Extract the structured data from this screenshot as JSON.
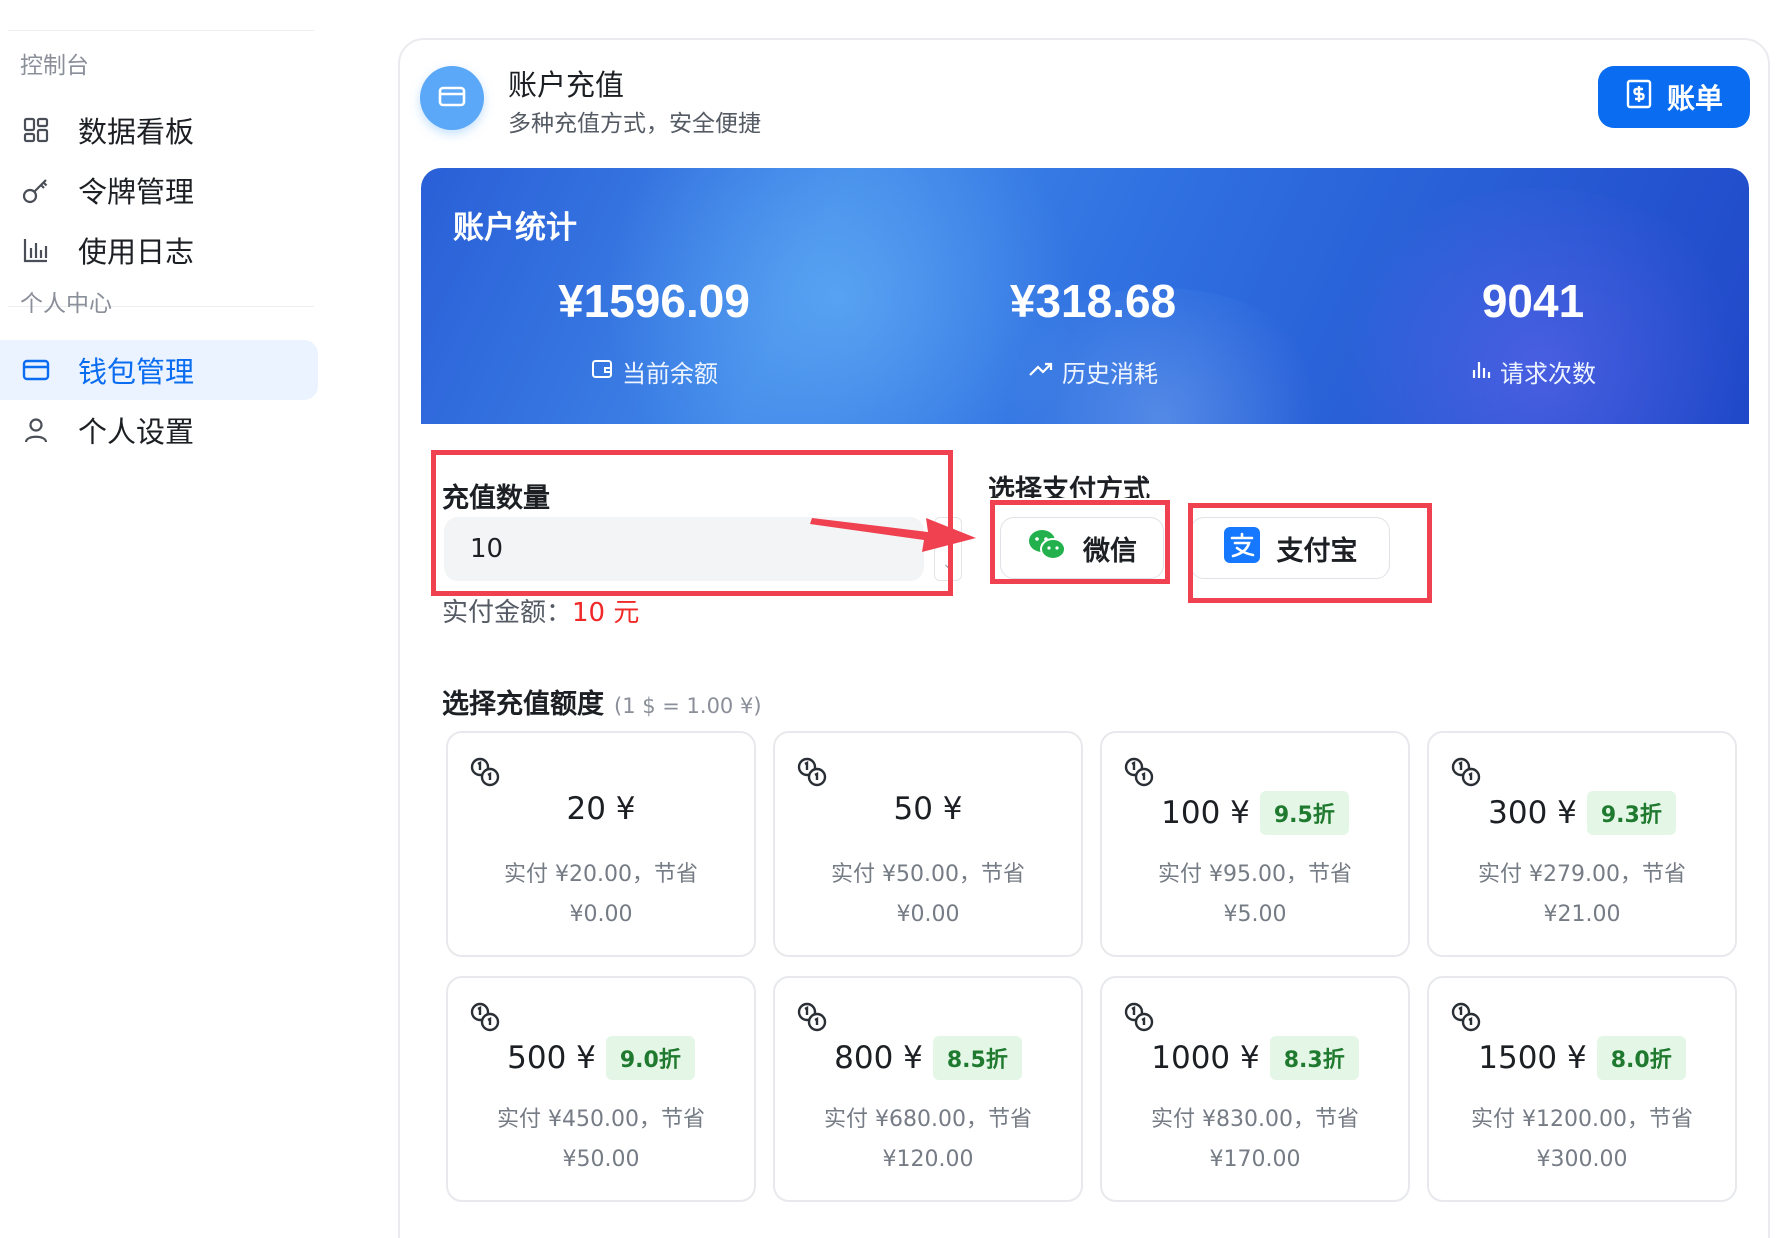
{
  "sidebar": {
    "section1": "控制台",
    "section2": "个人中心",
    "items": [
      {
        "label": "数据看板",
        "icon": "dashboard-icon"
      },
      {
        "label": "令牌管理",
        "icon": "key-icon"
      },
      {
        "label": "使用日志",
        "icon": "bar-chart-icon"
      },
      {
        "label": "钱包管理",
        "icon": "wallet-icon",
        "active": true
      },
      {
        "label": "个人设置",
        "icon": "user-icon"
      }
    ]
  },
  "header": {
    "title": "账户充值",
    "subtitle": "多种充值方式，安全便捷",
    "bill_label": "账单"
  },
  "stats": {
    "title": "账户统计",
    "items": [
      {
        "value": "¥1596.09",
        "label": "当前余额",
        "icon": "wallet-icon"
      },
      {
        "value": "¥318.68",
        "label": "历史消耗",
        "icon": "trend-icon"
      },
      {
        "value": "9041",
        "label": "请求次数",
        "icon": "bar-chart-icon"
      }
    ]
  },
  "form": {
    "amount_label": "充值数量",
    "amount_value": "10",
    "pay_prefix": "实付金额：",
    "pay_value": "10 元",
    "method_label": "选择支付方式",
    "wechat_label": "微信",
    "alipay_label": "支付宝"
  },
  "packages": {
    "title": "选择充值额度",
    "rate": "(1 $ = 1.00 ¥)",
    "items": [
      {
        "amount": "20 ¥",
        "discount": "",
        "line1": "实付 ¥20.00，节省",
        "line2": "¥0.00"
      },
      {
        "amount": "50 ¥",
        "discount": "",
        "line1": "实付 ¥50.00，节省",
        "line2": "¥0.00"
      },
      {
        "amount": "100 ¥",
        "discount": "9.5折",
        "line1": "实付 ¥95.00，节省",
        "line2": "¥5.00"
      },
      {
        "amount": "300 ¥",
        "discount": "9.3折",
        "line1": "实付 ¥279.00，节省",
        "line2": "¥21.00"
      },
      {
        "amount": "500 ¥",
        "discount": "9.0折",
        "line1": "实付 ¥450.00，节省",
        "line2": "¥50.00"
      },
      {
        "amount": "800 ¥",
        "discount": "8.5折",
        "line1": "实付 ¥680.00，节省",
        "line2": "¥120.00"
      },
      {
        "amount": "1000 ¥",
        "discount": "8.3折",
        "line1": "实付 ¥830.00，节省",
        "line2": "¥170.00"
      },
      {
        "amount": "1500 ¥",
        "discount": "8.0折",
        "line1": "实付 ¥1200.00，节省",
        "line2": "¥300.00"
      }
    ]
  },
  "colors": {
    "accent": "#0a6cf0",
    "annotation": "#ef4150",
    "pay_red": "#f02828",
    "discount_bg": "#e4f6e6",
    "discount_text": "#1f7a2f"
  }
}
